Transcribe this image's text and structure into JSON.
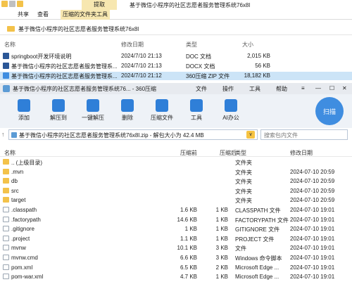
{
  "explorer": {
    "context_tab": "提取",
    "window_title": "基于微信小程序的社区志愿者服务管理系统76x8l",
    "ribbon_tabs": [
      "共享",
      "查看",
      "压缩的文件夹工具"
    ],
    "address_path": "基于微信小程序的社区志愿者服务管理系统76x8l",
    "columns": {
      "name": "名称",
      "modified": "修改日期",
      "type": "类型",
      "size": "大小"
    },
    "files": [
      {
        "name": "springboot开发环境说明",
        "modified": "2024/7/10 21:13",
        "type": "DOC 文档",
        "size": "2,015 KB",
        "color": "#2b5797"
      },
      {
        "name": "基于微信小程序的社区志愿者服务管理系...",
        "modified": "2024/7/10 21:13",
        "type": "DOCX 文档",
        "size": "56 KB",
        "color": "#2b5797"
      },
      {
        "name": "基于微信小程序的社区志愿者服务管理系...",
        "modified": "2024/7/10 21:12",
        "type": "360压缩 ZIP 文件",
        "size": "18,182 KB",
        "color": "#3f8de0",
        "selected": true
      }
    ]
  },
  "zip": {
    "title": "基于微信小程序的社区志愿者服务管理系统76... - 360压缩",
    "menu": [
      "文件",
      "操作",
      "工具",
      "帮助"
    ],
    "toolbar": [
      {
        "label": "添加",
        "icon": "add-icon",
        "color": "#2f7fd8"
      },
      {
        "label": "解压到",
        "icon": "extract-icon",
        "color": "#2f7fd8"
      },
      {
        "label": "一键解压",
        "icon": "one-click-extract-icon",
        "color": "#2f7fd8"
      },
      {
        "label": "删除",
        "icon": "delete-icon",
        "color": "#2f7fd8"
      },
      {
        "label": "压缩文件",
        "icon": "compress-icon",
        "color": "#2f7fd8"
      },
      {
        "label": "工具",
        "icon": "tools-icon",
        "color": "#2f7fd8"
      },
      {
        "label": "AI办公",
        "icon": "ai-icon",
        "color": "#2f7fd8"
      }
    ],
    "scan_label": "扫描",
    "path_text": "基于微信小程序的社区志愿者服务管理系统76x8l.zip - 解包大小为 42.4 MB",
    "search_placeholder": "搜索包内文件",
    "columns": {
      "name": "名称",
      "size": "压缩前",
      "packed": "压缩后",
      "type": "类型",
      "modified": "修改日期"
    },
    "entries": [
      {
        "name": ".. (上级目录)",
        "size": "",
        "packed": "",
        "type": "文件夹",
        "modified": "",
        "kind": "folder"
      },
      {
        "name": ".mvn",
        "size": "",
        "packed": "",
        "type": "文件夹",
        "modified": "2024-07-10 20:59",
        "kind": "folder"
      },
      {
        "name": "db",
        "size": "",
        "packed": "",
        "type": "文件夹",
        "modified": "2024-07-10 20:59",
        "kind": "folder"
      },
      {
        "name": "src",
        "size": "",
        "packed": "",
        "type": "文件夹",
        "modified": "2024-07-10 20:59",
        "kind": "folder"
      },
      {
        "name": "target",
        "size": "",
        "packed": "",
        "type": "文件夹",
        "modified": "2024-07-10 20:59",
        "kind": "folder"
      },
      {
        "name": ".classpath",
        "size": "1.6 KB",
        "packed": "1 KB",
        "type": "CLASSPATH 文件",
        "modified": "2024-07-10 19:01",
        "kind": "file"
      },
      {
        "name": ".factorypath",
        "size": "14.6 KB",
        "packed": "1 KB",
        "type": "FACTORYPATH 文件",
        "modified": "2024-07-10 19:01",
        "kind": "file"
      },
      {
        "name": ".gitignore",
        "size": "1 KB",
        "packed": "1 KB",
        "type": "GITIGNORE 文件",
        "modified": "2024-07-10 19:01",
        "kind": "file"
      },
      {
        "name": ".project",
        "size": "1.1 KB",
        "packed": "1 KB",
        "type": "PROJECT 文件",
        "modified": "2024-07-10 19:01",
        "kind": "file"
      },
      {
        "name": "mvnw",
        "size": "10.1 KB",
        "packed": "3 KB",
        "type": "文件",
        "modified": "2024-07-10 19:01",
        "kind": "file"
      },
      {
        "name": "mvnw.cmd",
        "size": "6.6 KB",
        "packed": "3 KB",
        "type": "Windows 命令脚本",
        "modified": "2024-07-10 19:01",
        "kind": "file"
      },
      {
        "name": "pom.xml",
        "size": "6.5 KB",
        "packed": "2 KB",
        "type": "Microsoft Edge ...",
        "modified": "2024-07-10 19:01",
        "kind": "file"
      },
      {
        "name": "pom-war.xml",
        "size": "4.7 KB",
        "packed": "1 KB",
        "type": "Microsoft Edge ...",
        "modified": "2024-07-10 19:01",
        "kind": "file"
      }
    ]
  }
}
